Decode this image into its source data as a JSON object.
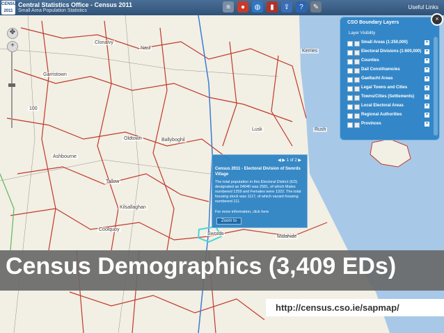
{
  "header": {
    "logo_text": "CENSUS 2011",
    "title": "Central Statistics Office - Census 2011",
    "subtitle": "Small Area Population Statistics",
    "useful_links": "Useful Links",
    "tools": [
      {
        "icon": "layers-icon",
        "color": "#7a8ea6"
      },
      {
        "icon": "location-pin-icon",
        "color": "#c83a2b"
      },
      {
        "icon": "globe-icon",
        "color": "#2f77c4"
      },
      {
        "icon": "book-icon",
        "color": "#b1322a"
      },
      {
        "icon": "export-icon",
        "color": "#3a6fb8"
      },
      {
        "icon": "help-icon",
        "color": "#2b64b0"
      },
      {
        "icon": "tools-icon",
        "color": "#6c7a8a"
      }
    ]
  },
  "layers_panel": {
    "title": "CSO Boundary Layers",
    "visibility_label": "Layer Visibility",
    "items": [
      "Small Areas (1:250,000)",
      "Electoral Divisions (1:600,000)",
      "Counties",
      "Dail Constituencies",
      "Gaeltacht Areas",
      "Legal Towns and Cities",
      "Towns/Cities (Settlements)",
      "Local Electoral Areas",
      "Regional Authorities",
      "Provinces"
    ]
  },
  "popup": {
    "nav": "1 of 2",
    "title": "Census 2011 - Electoral Division of Swords Village",
    "body": "The total population in this Electoral District (ED) designated as 04040 was 2581, of which Males numbered 1259 and Females were 1322. The total housing stock was 1117, of which vacant housing numbered 111.",
    "more_info": "For more information, click here",
    "zoom_button": "Zoom to"
  },
  "places": [
    "Clonalvy",
    "Naul",
    "Kerries",
    "Garristown",
    "Lusk",
    "Rush",
    "Ballyboghil",
    "Ashbourne",
    "Kilsallaghan",
    "Swords",
    "Malahide",
    "Coolquoy",
    "Oldtown",
    "Tallow",
    "100"
  ],
  "banner": {
    "text": "Census Demographics (3,409 EDs)",
    "url": "http://census.cso.ie/sapmap/"
  },
  "colors": {
    "header": "#2f5277",
    "panel": "#2981c4",
    "boundary": "#c0392b",
    "sea": "#a8c8e8",
    "banner": "#696969"
  }
}
